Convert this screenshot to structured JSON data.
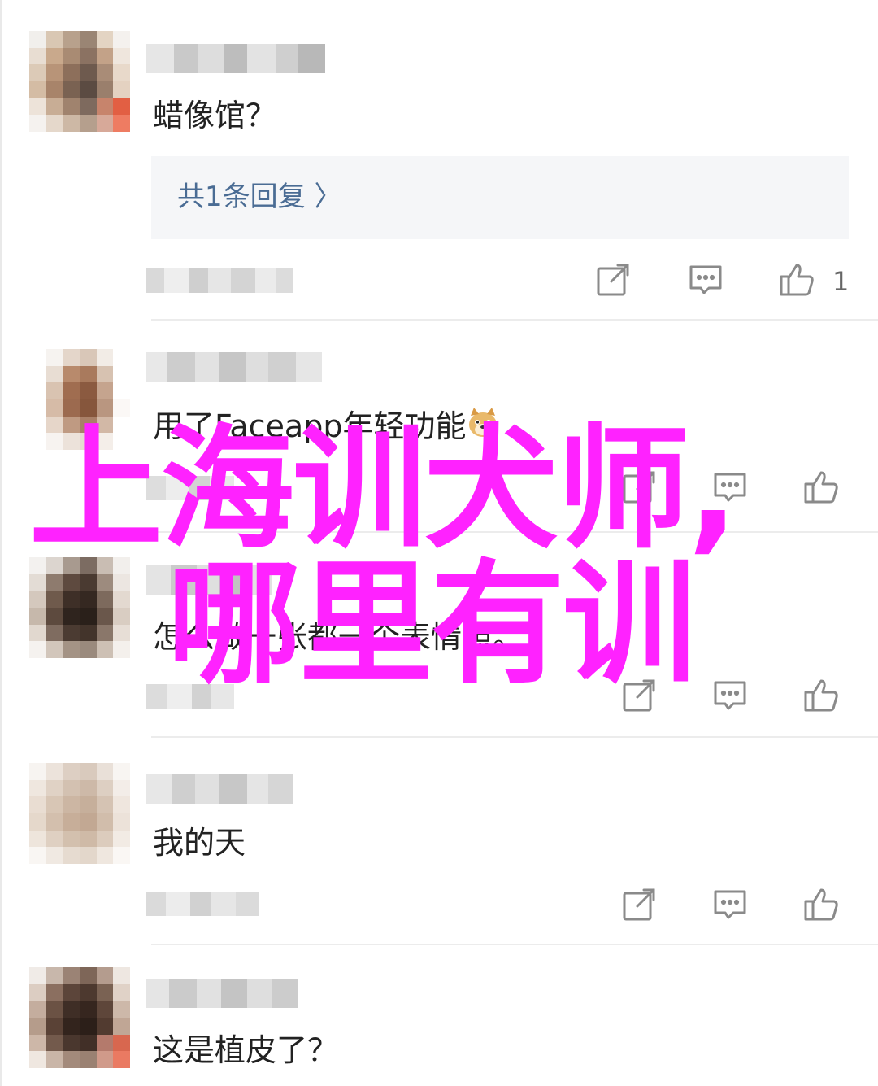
{
  "comments": [
    {
      "text": "蜡像馆？",
      "reply_link": "共1条回复 〉",
      "like_count": "1",
      "avatar_colors": [
        "#f1efec",
        "#d9c7b3",
        "#b8a18c",
        "#9a8574",
        "#e3d4c3",
        "#f4f1ee",
        "#e8ddd2",
        "#c9a98c",
        "#a98b73",
        "#8b7262",
        "#c3a288",
        "#efe6dd",
        "#dccab7",
        "#b89478",
        "#8d6f5b",
        "#6e5a4e",
        "#a98c77",
        "#e8d9ca",
        "#d4bca4",
        "#a8846a",
        "#7a6252",
        "#5b4b42",
        "#9a7f6c",
        "#e4d2c1",
        "#ede3d9",
        "#c8ad95",
        "#a0836e",
        "#7e6a5e",
        "#c7846c",
        "#e25f43",
        "#f5f2ef",
        "#e5d8cb",
        "#cdb8a5",
        "#b59f8d",
        "#d7a999",
        "#ee7c62"
      ]
    },
    {
      "text": "用了Faceapp年轻功能",
      "emoji": "dog-emoji",
      "avatar_colors": [
        "#ffffff",
        "#f6f3f0",
        "#e4d6ca",
        "#d9c7b8",
        "#f2ece6",
        "#ffffff",
        "#ffffff",
        "#e8ddd3",
        "#b88a6c",
        "#a97a5d",
        "#d7c2b1",
        "#ffffff",
        "#ffffff",
        "#d9c3b1",
        "#a06d50",
        "#8b5a40",
        "#c5a48e",
        "#ffffff",
        "#ffffff",
        "#d6bba7",
        "#9c6a4f",
        "#86563c",
        "#b99680",
        "#fbf8f6",
        "#ffffff",
        "#e6d6c9",
        "#bf9a82",
        "#a98068",
        "#d2b8a6",
        "#ffffff",
        "#ffffff",
        "#f7f3f0",
        "#ece2da",
        "#e6dad0",
        "#f4eee9",
        "#ffffff"
      ]
    },
    {
      "text": "怎么做一张都一个表情照。",
      "avatar_colors": [
        "#f3f1ef",
        "#dcd5cf",
        "#a89a8f",
        "#7c6c62",
        "#c9bdb3",
        "#f2efec",
        "#e3dcd5",
        "#8e7b6e",
        "#5e4a3f",
        "#4a3a31",
        "#9d8b7e",
        "#ece6e1",
        "#d4c8bd",
        "#6f5a4c",
        "#3e2f27",
        "#352821",
        "#7d6a5d",
        "#e3d9d0",
        "#c6b8ab",
        "#5d4a3e",
        "#2f241e",
        "#2a201a",
        "#6a574b",
        "#d9cdc2",
        "#e1d8cf",
        "#7f6c60",
        "#4b3b32",
        "#43342b",
        "#8a776a",
        "#e7ded6",
        "#f5f2ef",
        "#d2c6bb",
        "#a49385",
        "#9a8a7d",
        "#cdc0b4",
        "#f4f0ec"
      ]
    },
    {
      "text": "我的天",
      "avatar_colors": [
        "#f7f4f1",
        "#ece3db",
        "#ddcfc3",
        "#d9cabd",
        "#e9e0d8",
        "#f8f5f2",
        "#efe7df",
        "#e0d2c5",
        "#d3c1b1",
        "#cdb9a8",
        "#ddcfc2",
        "#f3ede8",
        "#e9ddd2",
        "#d8c6b5",
        "#ccb6a3",
        "#c6af9b",
        "#d5c3b3",
        "#efe6de",
        "#e5d8cb",
        "#d3bfad",
        "#c7ae99",
        "#c2a893",
        "#d1bdab",
        "#ece2d9",
        "#eee5dc",
        "#dfd0c2",
        "#d3c0ae",
        "#cfbaa7",
        "#dcccbd",
        "#f2ebe4",
        "#f9f6f3",
        "#f0e9e2",
        "#e6dbd0",
        "#e3d7cb",
        "#efe7df",
        "#faf7f4"
      ]
    },
    {
      "text": "这是植皮了？",
      "avatar_colors": [
        "#f0ebe7",
        "#c8b7ab",
        "#9b8375",
        "#7e6658",
        "#b49c8e",
        "#eee7e1",
        "#dccdc2",
        "#8b6f60",
        "#5c453a",
        "#4d392f",
        "#7a6253",
        "#e0d2c7",
        "#c4ad9e",
        "#6b5244",
        "#3f2e26",
        "#36261f",
        "#5e463a",
        "#cdb8a9",
        "#b59c8b",
        "#5a4236",
        "#33241d",
        "#2c1f19",
        "#523b30",
        "#c0a695",
        "#cdb7a8",
        "#735a4c",
        "#4a372e",
        "#412f27",
        "#b47a6c",
        "#d8674f",
        "#efe7e0",
        "#c9b5a7",
        "#a38a7b",
        "#9a8172",
        "#d09a8a",
        "#ea7a62"
      ]
    }
  ],
  "watermark": {
    "line1": "上海训犬师,",
    "line2": "哪里有训",
    "color": "#ff22ff"
  },
  "actions": {
    "share_icon": "share-edit-icon",
    "reply_icon": "comment-bubble-icon",
    "like_icon": "thumbs-up-icon"
  }
}
